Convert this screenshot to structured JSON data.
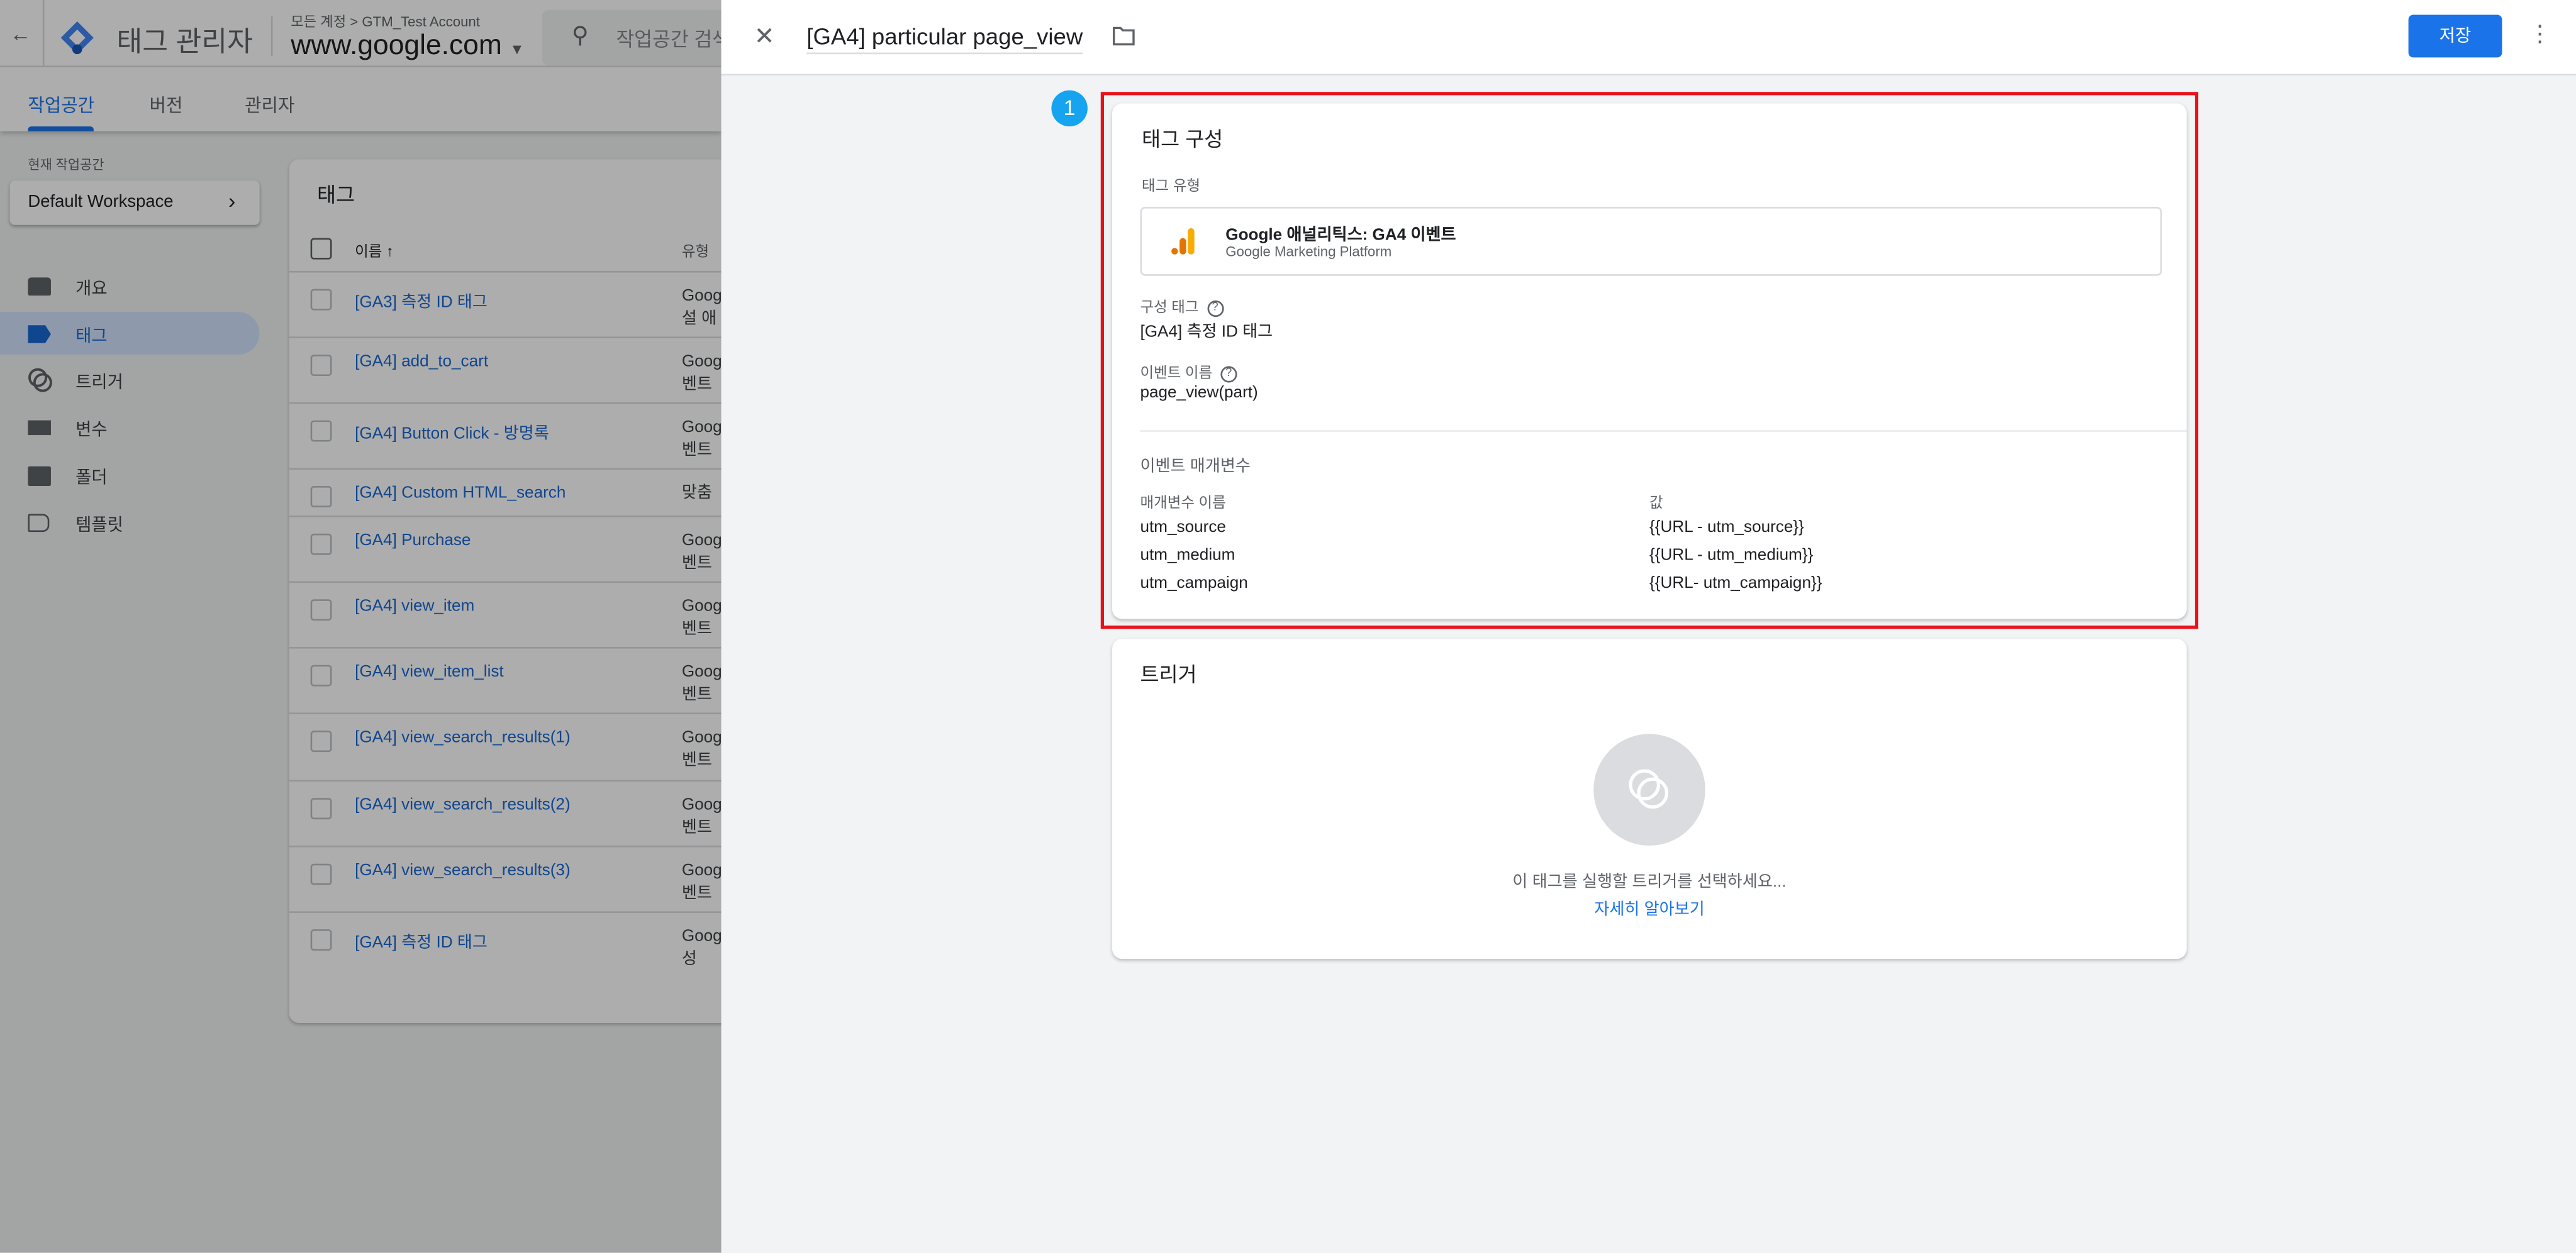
{
  "app": {
    "title": "태그 관리자",
    "breadcrumb": "모든 계정 > GTM_Test Account",
    "container": "www.google.com",
    "search_placeholder": "작업공간 검색"
  },
  "tabs": [
    {
      "label": "작업공간",
      "active": true
    },
    {
      "label": "버전"
    },
    {
      "label": "관리자"
    }
  ],
  "sidebar": {
    "workspace_label": "현재 작업공간",
    "workspace_name": "Default Workspace",
    "items": [
      {
        "label": "개요",
        "icon": "overview-icon"
      },
      {
        "label": "태그",
        "icon": "tag-icon",
        "active": true
      },
      {
        "label": "트리거",
        "icon": "trigger-icon"
      },
      {
        "label": "변수",
        "icon": "variable-icon"
      },
      {
        "label": "폴더",
        "icon": "folder-icon"
      },
      {
        "label": "템플릿",
        "icon": "template-icon"
      }
    ]
  },
  "tags_table": {
    "title": "태그",
    "columns": [
      "이름 ↑",
      "유형"
    ],
    "rows": [
      {
        "name": "[GA3] 측정 ID 태그",
        "type": [
          "Goog",
          "설 애"
        ]
      },
      {
        "name": "[GA4] add_to_cart",
        "type": [
          "Goog",
          "벤트"
        ]
      },
      {
        "name": "[GA4] Button Click - 방명록",
        "type": [
          "Goog",
          "벤트"
        ]
      },
      {
        "name": "[GA4] Custom HTML_search",
        "type": [
          "맞춤"
        ]
      },
      {
        "name": "[GA4] Purchase",
        "type": [
          "Goog",
          "벤트"
        ]
      },
      {
        "name": "[GA4] view_item",
        "type": [
          "Goog",
          "벤트"
        ]
      },
      {
        "name": "[GA4] view_item_list",
        "type": [
          "Goog",
          "벤트"
        ]
      },
      {
        "name": "[GA4] view_search_results(1)",
        "type": [
          "Goog",
          "벤트"
        ]
      },
      {
        "name": "[GA4] view_search_results(2)",
        "type": [
          "Goog",
          "벤트"
        ]
      },
      {
        "name": "[GA4] view_search_results(3)",
        "type": [
          "Goog",
          "벤트"
        ]
      },
      {
        "name": "[GA4] 측정 ID 태그",
        "type": [
          "Goog",
          "성"
        ]
      }
    ]
  },
  "editor": {
    "tag_name": "[GA4] particular page_view",
    "save_label": "저장",
    "badge": "1",
    "config": {
      "title": "태그 구성",
      "type_label": "태그 유형",
      "type_name": "Google 애널리틱스: GA4 이벤트",
      "type_vendor": "Google Marketing Platform",
      "config_tag_label": "구성 태그",
      "config_tag_value": "[GA4] 측정 ID 태그",
      "event_name_label": "이벤트 이름",
      "event_name_value": "page_view(part)",
      "params_title": "이벤트 매개변수",
      "param_name_header": "매개변수 이름",
      "param_value_header": "값",
      "params": [
        {
          "name": "utm_source",
          "value": "{{URL - utm_source}}"
        },
        {
          "name": "utm_medium",
          "value": "{{URL - utm_medium}}"
        },
        {
          "name": "utm_campaign",
          "value": "{{URL- utm_campaign}}"
        }
      ]
    },
    "trigger": {
      "title": "트리거",
      "empty_text": "이 태그를 실행할 트리거를 선택하세요...",
      "learn_more": "자세히 알아보기"
    }
  },
  "colors": {
    "accent": "#1a73e8",
    "highlight_box": "#e8121b",
    "badge": "#16a3f0",
    "ga_orange": "#f9ab00"
  }
}
